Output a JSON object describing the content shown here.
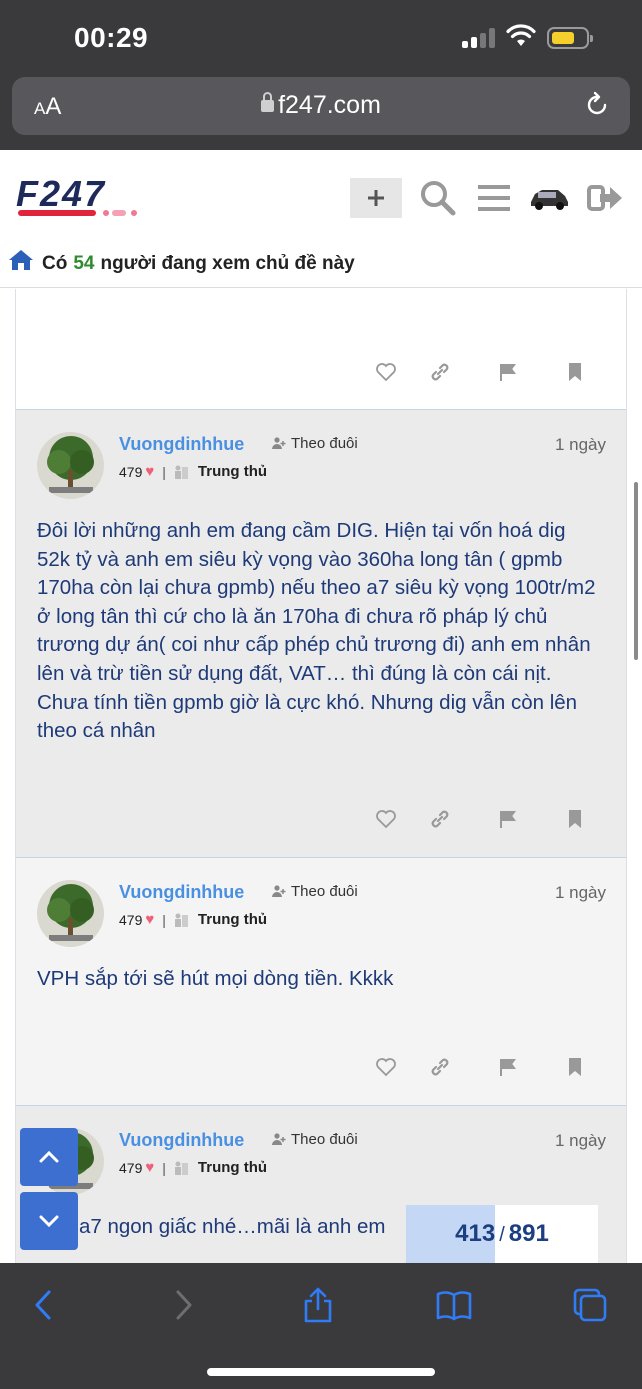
{
  "status_bar": {
    "time": "00:29",
    "battery_color": "#f5d02c"
  },
  "address_bar": {
    "aa_small": "A",
    "aa_large": "A",
    "url": "f247.com"
  },
  "site": {
    "logo_text": "F247",
    "topic_bar": {
      "prefix": "Có",
      "count": "54",
      "suffix": "người đang xem chủ đề này"
    }
  },
  "posts": [
    {
      "username": "Vuongdinhhue",
      "follow": "Theo đuôi",
      "time": "1 ngày",
      "likes": "479",
      "rank": "Trung thủ",
      "body": "Đôi lời những anh em đang cầm DIG. Hiện tại vốn hoá dig 52k tỷ và anh em siêu kỳ vọng vào 360ha long tân ( gpmb 170ha còn lại chưa gpmb) nếu theo a7 siêu kỳ vọng 100tr/m2 ở long tân thì cứ cho là ăn 170ha đi chưa rõ pháp lý chủ trương dự án( coi như cấp phép chủ trương đi) anh em nhân lên và trừ tiền sử dụng đất, VAT… thì đúng là còn cái nịt. Chưa tính tiền gpmb giờ là cực khó. Nhưng dig vẫn còn lên theo cá nhân"
    },
    {
      "username": "Vuongdinhhue",
      "follow": "Theo đuôi",
      "time": "1 ngày",
      "likes": "479",
      "rank": "Trung thủ",
      "body": "VPH sắp tới sẽ hút mọi dòng tiền. Kkkk"
    },
    {
      "username": "Vuongdinhhue",
      "follow": "Theo đuôi",
      "time": "1 ngày",
      "likes": "479",
      "rank": "Trung thủ",
      "body": "c a7 ngon giấc nhé…mãi là anh em"
    }
  ],
  "progress": {
    "current": "413",
    "total": "891",
    "fraction": 0.4635
  },
  "colors": {
    "accent": "#4a90e2",
    "body_text": "#1e3a78",
    "nav_button": "#3d6fd0",
    "toolbar_icon": "#2f7cf6"
  }
}
